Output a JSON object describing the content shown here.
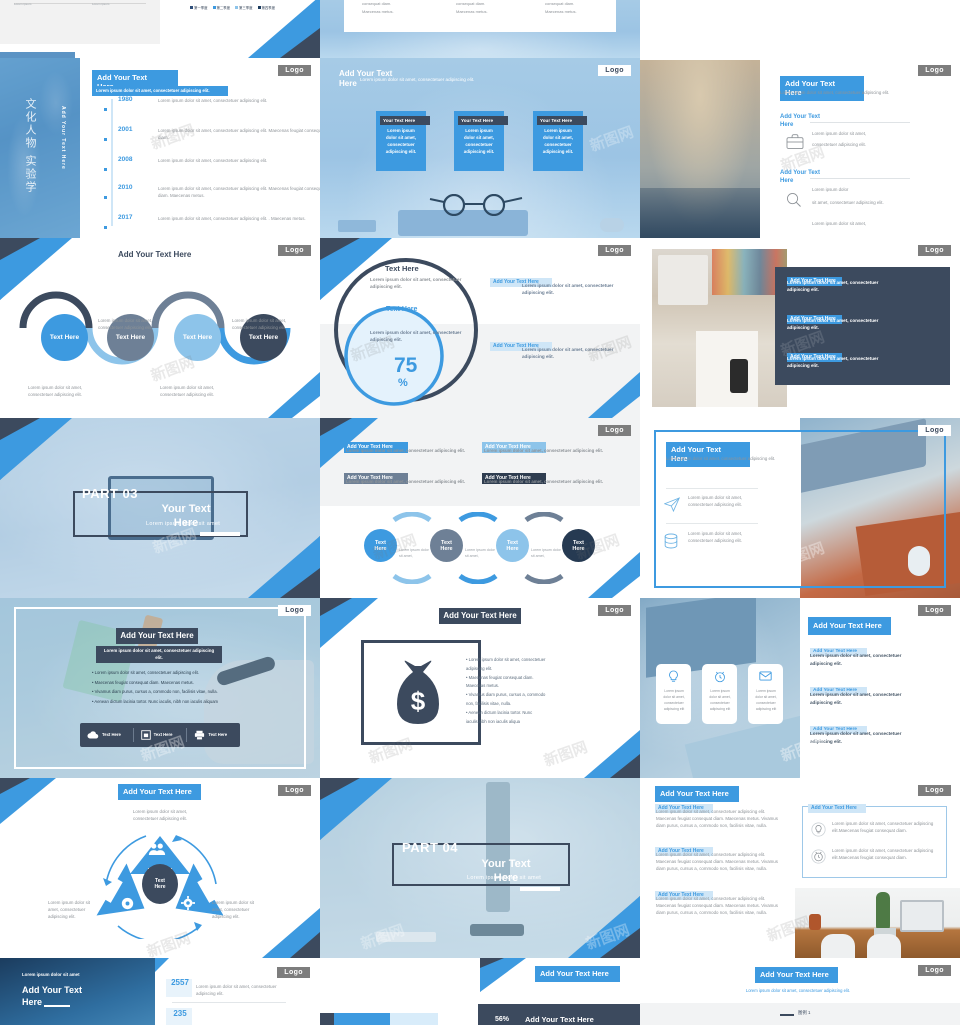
{
  "common": {
    "logo_label": "Logo",
    "watermark": "新图网",
    "title_text": "Add Your Text Here",
    "text_here": "Text Here",
    "your_text_here": "Your Text Here",
    "lorem_short": "Lorem ipsum dolor sit amet, consectetuer adipiscing elit.",
    "lorem_medium": "Lorem ipsum dolor sit amet, consectetuer adipiscing elit. Maecenas feugiat consequat diam.",
    "lorem_long": "Lorem ipsum dolor sit amet, consectetuer adipiscing elit. Maecenas feugiat consequat diam. Maecenas metus. Vivamus diam purus, cursus a, commodo non, facilisis vitae, nulla.",
    "colors": {
      "blue": "#3d9ae0",
      "light_blue": "#8dc4ea",
      "pale_blue": "#cfe6f7",
      "dark_navy": "#3c4a5e",
      "slate": "#6e8096",
      "grey_text": "#8e9398"
    }
  },
  "row_top": {
    "slide_a": {
      "legend": [
        "第一季度",
        "第二季度",
        "第三季度",
        "第四季度"
      ]
    },
    "slide_b": {
      "cols": [
        {
          "line1": "consequat diam.",
          "line2": "Maecenas metus."
        },
        {
          "line1": "consequat diam.",
          "line2": "Maecenas metus."
        },
        {
          "line1": "consequat diam.",
          "line2": "Maecenas metus."
        }
      ]
    }
  },
  "slides": [
    {
      "id": "timeline",
      "title": "Add Your Text Here",
      "subtitle": "Lorem ipsum dolor sit amet, consectetuer adipiscing elit.",
      "side_caption": "Add Your Text Here",
      "side_chinese": "文化人物 实验学",
      "items": [
        {
          "year": "1980",
          "text": "Lorem ipsum dolor sit amet, consectetuer adipiscing elit."
        },
        {
          "year": "2001",
          "text": "Lorem ipsum dolor sit amet, consectetuer adipiscing elit. Maecenas feugiat consequat diam."
        },
        {
          "year": "2008",
          "text": "Lorem ipsum dolor sit amet, consectetuer adipiscing elit."
        },
        {
          "year": "2010",
          "text": "Lorem ipsum dolor sit amet, consectetuer adipiscing elit. Maecenas feugiat consequat diam. Maecenas metus."
        },
        {
          "year": "2017",
          "text": "Lorem ipsum dolor sit amet, consectetuer adipiscing elit. . Maecenas metus."
        }
      ]
    },
    {
      "id": "three-cards",
      "title": "Add Your Text Here",
      "subtitle": "Lorem ipsum dolor sit amet, consectetuer adipiscing elit.",
      "cards": [
        {
          "heading": "Your Text Here",
          "body": "Lorem ipsum dolor sit amet, consectetuer adipiscing elit."
        },
        {
          "heading": "Your Text Here",
          "body": "Lorem ipsum dolor sit amet, consectetuer adipiscing elit."
        },
        {
          "heading": "Your Text Here",
          "body": "Lorem ipsum dolor sit amet, consectetuer adipiscing elit."
        }
      ]
    },
    {
      "id": "icon-list",
      "title": "Add Your Text Here",
      "subtitle": "Lorem ipsum dolor sit amet, consectetuer adipiscing elit.",
      "sections": [
        {
          "heading": "Add Your Text Here",
          "icon": "briefcase-icon",
          "bullets": [
            "Lorem ipsum dolor sit amet,",
            "consectetuer adipiscing elit."
          ]
        },
        {
          "heading": "Add Your Text Here",
          "icon": "magnifier-icon",
          "bullets": [
            "Lorem ipsum dolor",
            "sit amet, consectetuer adipiscing elit.",
            "Lorem ipsum dolor sit amet,"
          ]
        }
      ]
    },
    {
      "id": "wave-four",
      "title": "Add Your Text Here",
      "nodes": [
        {
          "label": "Text Here",
          "caption": "Lorem ipsum dolor sit amet, consectetuer adipiscing elit.",
          "color": "#3d9ae0",
          "pos": "below"
        },
        {
          "label": "Text Here",
          "caption": "Lorem ipsum dolor sit amet, consectetuer adipiscing elit.",
          "color": "#6e8096",
          "pos": "above"
        },
        {
          "label": "Text Here",
          "caption": "Lorem ipsum dolor sit amet, consectetuer adipiscing elit.",
          "color": "#8dc4ea",
          "pos": "below"
        },
        {
          "label": "Text Here",
          "caption": "Lorem ipsum dolor sit amet, consectetuer adipiscing elit.",
          "color": "#3c4a5e",
          "pos": "above"
        }
      ]
    },
    {
      "id": "donut-75",
      "outer_heading": "Text Here",
      "outer_body": "Lorem ipsum dolor sit amet, consectetuer adipiscing elit.",
      "inner_heading": "Text Here",
      "inner_body": "Lorem ipsum dolor sit amet, consectetuer adipiscing elit.",
      "value": "75",
      "unit": "%",
      "side_blocks": [
        {
          "heading": "Add Your Text Here",
          "body": "Lorem ipsum dolor sit amet, consectetuer adipiscing elit."
        },
        {
          "heading": "Add Your Text Here",
          "body": "Lorem ipsum dolor sit amet, consectetuer adipiscing elit."
        }
      ]
    },
    {
      "id": "dark-panel",
      "blocks": [
        {
          "heading": "Add Your Text Here",
          "body": "Lorem ipsum dolor sit amet, consectetuer adipiscing elit."
        },
        {
          "heading": "Add Your Text Here",
          "body": "Lorem ipsum dolor sit amet, consectetuer adipiscing elit."
        },
        {
          "heading": "Add Your Text Here",
          "body": "Lorem ipsum dolor sit amet, consectetuer adipiscing elit."
        }
      ]
    },
    {
      "id": "part-03",
      "part_label": "PART 03",
      "title": "Your Text Here",
      "subtitle": "Lorem ipsum dolor sit amet"
    },
    {
      "id": "four-blocks-chevrons",
      "blocks": [
        {
          "heading": "Add Your Text Here",
          "body": "Lorem ipsum dolor sit amet, consectetuer adipiscing elit.",
          "style": "blue"
        },
        {
          "heading": "Add Your Text Here",
          "body": "Lorem ipsum dolor sit amet, consectetuer adipiscing elit.",
          "style": "lightblue"
        },
        {
          "heading": "Add Your Text Here",
          "body": "Lorem ipsum dolor sit amet, consectetuer adipiscing elit.",
          "style": "slate"
        },
        {
          "heading": "Add Your Text Here",
          "body": "Lorem ipsum dolor sit amet, consectetuer adipiscing elit.",
          "style": "navy"
        }
      ],
      "nodes": [
        {
          "label": "Text Here",
          "color": "#3d9ae0"
        },
        {
          "label": "Text Here",
          "color": "#6e8096"
        },
        {
          "label": "Text Here",
          "color": "#8dc4ea"
        },
        {
          "label": "Text Here",
          "color": "#263a52"
        }
      ],
      "connector_captions": [
        "Lorem ipsum dolor sit amet,",
        "Lorem ipsum dolor sit amet,",
        "Lorem ipsum dolor sit amet,"
      ]
    },
    {
      "id": "keyboard-split",
      "title": "Add Your Text Here",
      "subtitle": "Lorem ipsum dolor sit amet, consectetuer adipiscing elit.",
      "rows": [
        {
          "icon": "paper-plane-icon",
          "text": "Lorem ipsum dolor sit amet, consectetuer adipiscing elit."
        },
        {
          "icon": "database-icon",
          "text": "Lorem ipsum dolor sit amet, consectetuer adipiscing elit."
        }
      ]
    },
    {
      "id": "pen-frame",
      "title": "Add Your Text Here",
      "subtitle": "Lorem ipsum dolor sit amet, consectetuer adipiscing elit.",
      "bullets": [
        "Lorem ipsum dolor sit amet, consectetuer adipiscing elit.",
        "Maecenas feugiat consequat diam. Maecenas metus.",
        "Vivamus diam purus, cursus a, commodo non, facilisis vitae, nulla.",
        "Aenean dictum lacinia tortor. Nunc iaculis, nibh non iaculis aliquam"
      ],
      "footer_items": [
        {
          "icon": "cloud-upload-icon",
          "label": "Text Here"
        },
        {
          "icon": "monitor-icon",
          "label": "Text Here"
        },
        {
          "icon": "printer-icon",
          "label": "Text Here"
        }
      ]
    },
    {
      "id": "money-bag",
      "title": "Add Your Text Here",
      "icon": "money-bag-icon",
      "bullets": [
        "Lorem ipsum dolor sit amet, consectetuer adipiscing elit.",
        "Maecenas feugiat consequat diam. Maecenas metus.",
        "Vivamus diam purus, cursus a, commodo non, facilisis vitae, nulla.",
        "Aenean dictum lacinia tortor. Nunc iaculis,nibh non iaculis aliqua"
      ]
    },
    {
      "id": "laptop-cards",
      "title": "Add Your Text Here",
      "cards": [
        {
          "icon": "lightbulb-icon",
          "body": "Lorem ipsum dolor sit amet, consectetuer adipiscing elit"
        },
        {
          "icon": "alarm-clock-icon",
          "body": "Lorem ipsum dolor sit amet, consectetuer adipiscing elit"
        },
        {
          "icon": "envelope-icon",
          "body": "Lorem ipsum dolor sit amet, consectetuer adipiscing elit"
        }
      ],
      "blocks": [
        {
          "heading": "Add Your Text Here",
          "body": "Lorem ipsum dolor sit amet, consectetuer adipiscing elit."
        },
        {
          "heading": "Add Your Text Here",
          "body": "Lorem ipsum dolor sit amet, consectetuer adipiscing elit."
        },
        {
          "heading": "Add Your Text Here",
          "body": "Lorem ipsum dolor sit amet, consectetuer adipiscing elit."
        }
      ]
    },
    {
      "id": "triangle-cycle",
      "title": "Add Your Text Here",
      "subtitle": "Lorem ipsum dolor sit amet, consectetuer adipiscing elit.",
      "center_label": "Text Here",
      "nodes": [
        {
          "icon": "users-icon",
          "caption": ""
        },
        {
          "icon": "phone-icon",
          "caption": "Lorem ipsum dolor sit amet, consectetuer adipiscing elit."
        },
        {
          "icon": "gear-icon",
          "caption": "Lorem ipsum dolor sit amet, consectetuer adipiscing elit."
        }
      ]
    },
    {
      "id": "part-04",
      "part_label": "PART 04",
      "title": "Your Text Here",
      "subtitle": "Lorem ipsum dolor sit amet"
    },
    {
      "id": "text-columns",
      "title": "Add Your Text Here",
      "blocks": [
        {
          "heading": "Add Your Text Here",
          "body": "Lorem ipsum dolor sit amet, consectetuer adipiscing elit. Maecenas feugiat consequat diam. Maecenas metus. Vivamus diam purus, cursus a, commodo non, facilisis vitae, nulla."
        },
        {
          "heading": "Add Your Text Here",
          "body": "Lorem ipsum dolor sit amet, consectetuer adipiscing elit. Maecenas feugiat consequat diam. Maecenas metus. Vivamus diam purus, cursus a, commodo non, facilisis vitae, nulla."
        },
        {
          "heading": "Add Your Text Here",
          "body": "Lorem ipsum dolor sit amet, consectetuer adipiscing elit. Maecenas feugiat consequat diam. Maecenas metus. Vivamus diam purus, cursus a, commodo non, facilisis vitae, nulla."
        }
      ],
      "panel": {
        "heading": "Add Your Text Here",
        "rows": [
          {
            "icon": "lightbulb-icon",
            "text": "Lorem ipsum dolor sit amet, consectetuer adipiscing elit.Maecenas feugiat consequat diam."
          },
          {
            "icon": "alarm-clock-icon",
            "text": "Lorem ipsum dolor sit amet, consectetuer adipiscing elit.Maecenas feugiat consequat diam."
          }
        ]
      }
    }
  ],
  "row_bottom": {
    "slide_a": {
      "caption": "Lorem ipsum dolor sit amet",
      "title": "Add Your Text Here"
    },
    "slide_b": {
      "stats": [
        {
          "value": "2557",
          "text": "Lorem ipsum dolor sit amet, consectetuer adipiscing elit."
        },
        {
          "value": "235",
          "text": ""
        }
      ]
    },
    "slide_c": {
      "percent_label": "56%",
      "title": "Add Your Text Here"
    },
    "slide_d": {
      "title": "Add Your Text Here",
      "subtitle": "Lorem ipsum dolor sit amet, consectetuer adipiscing elit.",
      "footer": "图例 1"
    }
  }
}
